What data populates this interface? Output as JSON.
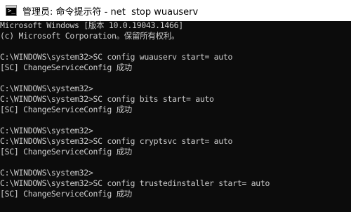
{
  "window": {
    "title": "管理员: 命令提示符 - net  stop wuauserv",
    "icon": "cmd-icon",
    "icon_glyph": ">_"
  },
  "console": {
    "lines": [
      "Microsoft Windows [版本 10.0.19043.1466]",
      "(c) Microsoft Corporation。保留所有权利。",
      "",
      "C:\\WINDOWS\\system32>SC config wuauserv start= auto",
      "[SC] ChangeServiceConfig 成功",
      "",
      "C:\\WINDOWS\\system32>",
      "C:\\WINDOWS\\system32>SC config bits start= auto",
      "[SC] ChangeServiceConfig 成功",
      "",
      "C:\\WINDOWS\\system32>",
      "C:\\WINDOWS\\system32>SC config cryptsvc start= auto",
      "[SC] ChangeServiceConfig 成功",
      "",
      "C:\\WINDOWS\\system32>",
      "C:\\WINDOWS\\system32>SC config trustedinstaller start= auto",
      "[SC] ChangeServiceConfig 成功"
    ]
  },
  "colors": {
    "console_bg": "#0c0c0c",
    "console_fg": "#cccccc",
    "titlebar_bg": "#ffffff"
  }
}
